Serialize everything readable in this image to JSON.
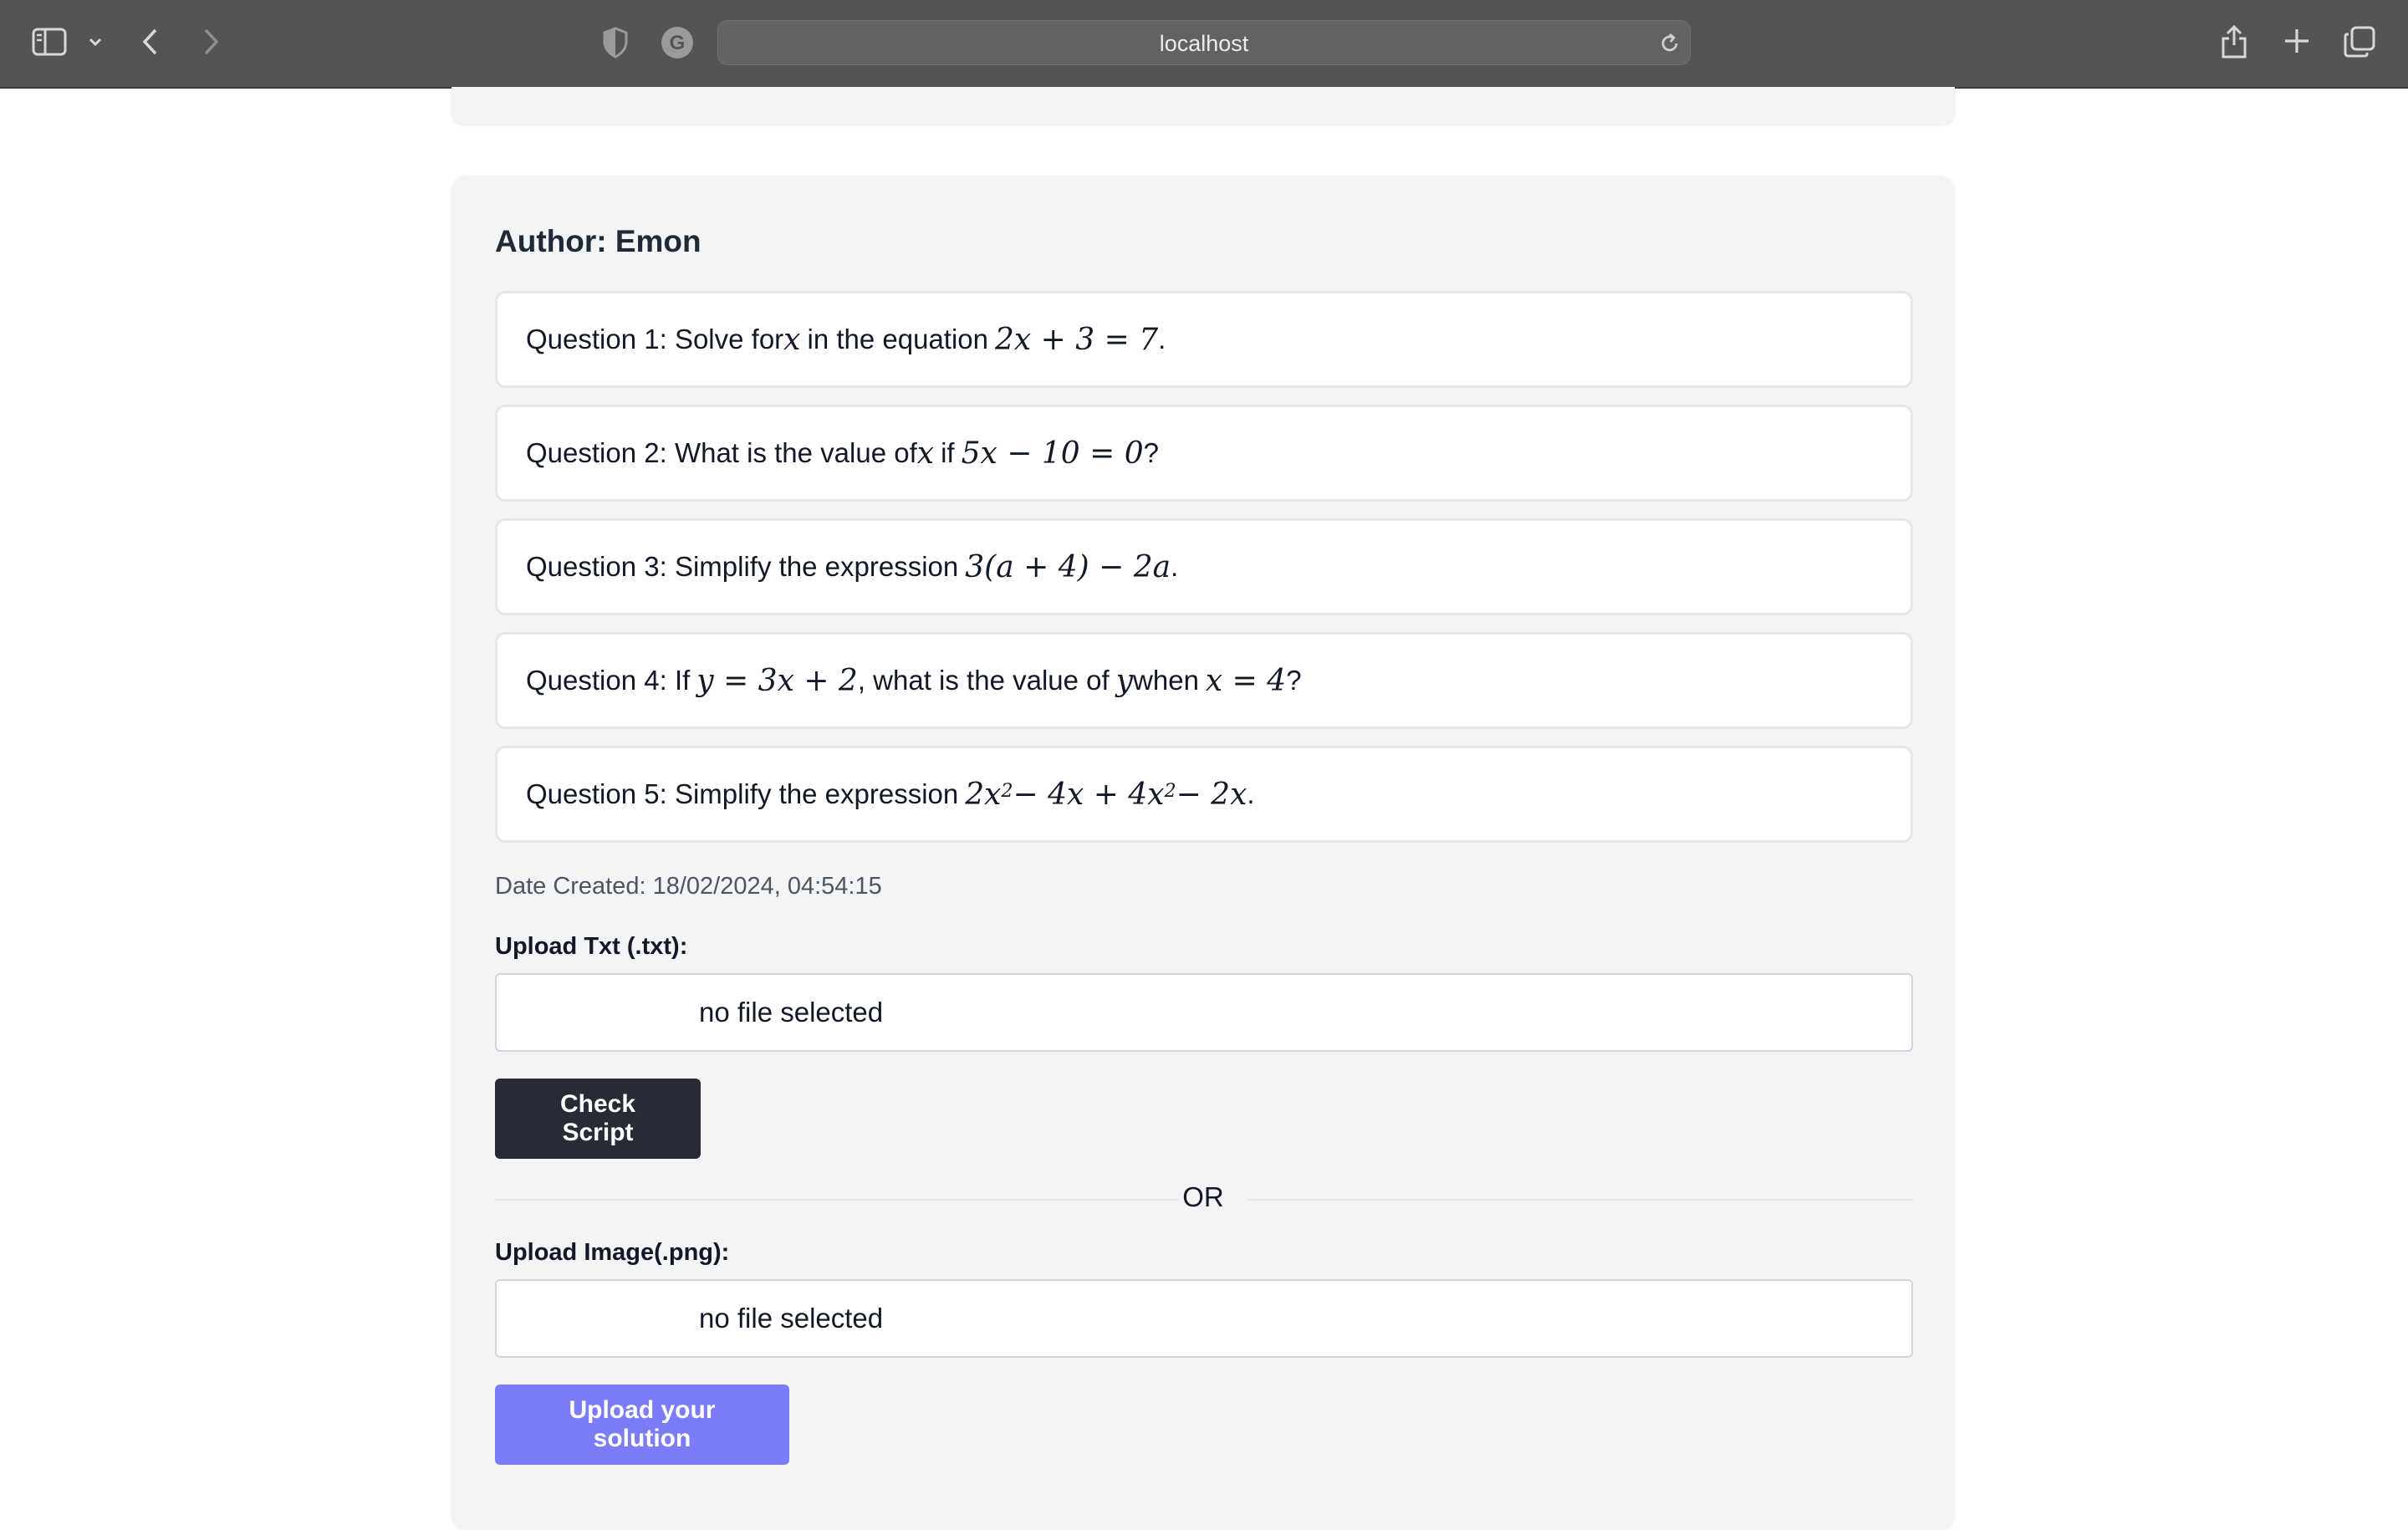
{
  "browser": {
    "address": "localhost",
    "icons": [
      "sidebar-icon",
      "chevron-down-icon",
      "back-icon",
      "forward-icon",
      "shield-icon",
      "grammarly-icon",
      "reload-icon",
      "share-icon",
      "new-tab-icon",
      "tabs-overview-icon"
    ]
  },
  "card": {
    "author_label": "Author: Emon",
    "questions": [
      {
        "prefix": "Question 1: Solve for ",
        "m1": "x",
        "mid": " in the equation ",
        "m2": "2x + 3 = 7",
        "end": "."
      },
      {
        "prefix": "Question 2: What is the value of ",
        "m1": "x",
        "mid": " if ",
        "m2": "5x − 10 = 0",
        "end": "?"
      },
      {
        "prefix": "Question 3: Simplify the expression ",
        "m1": "3(a + 4) − 2a",
        "end": "."
      },
      {
        "prefix": "Question 4: If ",
        "m1": "y = 3x + 2",
        "mid": ", what is the value of ",
        "m2": "y",
        "mid2": " when ",
        "m3": "x = 4",
        "end": "?"
      },
      {
        "prefix": "Question 5: Simplify the expression ",
        "m1": "2x",
        "sup1": "2",
        "m2": " − 4x + 4x",
        "sup2": "2",
        "m3": " − 2x",
        "end": "."
      }
    ],
    "date_created": "Date Created: 18/02/2024, 04:54:15",
    "upload_txt": {
      "label": "Upload Txt (.txt):",
      "status": "no file selected"
    },
    "check_button": "Check Script",
    "divider": "OR",
    "upload_image": {
      "label": "Upload Image(.png):",
      "status": "no file selected"
    },
    "upload_button": "Upload your solution"
  },
  "colors": {
    "toolbar": "#545456",
    "card_bg": "#f3f4f6",
    "check_button": "#262b35",
    "upload_button": "#7c7cf8"
  }
}
